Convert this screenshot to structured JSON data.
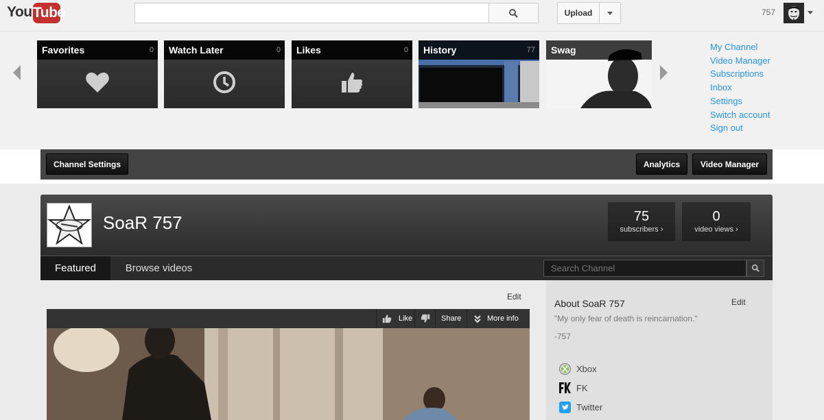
{
  "header": {
    "logo_you": "You",
    "logo_tube": "Tube",
    "search_placeholder": "",
    "upload_label": "Upload",
    "username": "757"
  },
  "guide": {
    "tiles": [
      {
        "title": "Favorites",
        "count": "0",
        "icon": "heart-icon"
      },
      {
        "title": "Watch Later",
        "count": "0",
        "icon": "clock-icon"
      },
      {
        "title": "Likes",
        "count": "0",
        "icon": "thumbs-up-icon"
      },
      {
        "title": "History",
        "count": "77",
        "icon": "history-thumbnail"
      },
      {
        "title": "Swag",
        "count": "",
        "icon": "swag-thumbnail"
      }
    ],
    "links": [
      "My Channel",
      "Video Manager",
      "Subscriptions",
      "Inbox",
      "Settings",
      "Switch account",
      "Sign out"
    ]
  },
  "owner_bar": {
    "channel_settings": "Channel Settings",
    "analytics": "Analytics",
    "video_manager": "Video Manager"
  },
  "channel": {
    "name": "SoaR 757",
    "subscribers": {
      "value": "75",
      "label": "subscribers ›"
    },
    "video_views": {
      "value": "0",
      "label": "video views ›"
    },
    "tabs": [
      "Featured",
      "Browse videos"
    ],
    "active_tab": "Featured",
    "search_placeholder": "Search Channel"
  },
  "featured": {
    "edit_label": "Edit",
    "actions": {
      "like": "Like",
      "share": "Share",
      "more": "More info"
    }
  },
  "about": {
    "title": "About SoaR 757",
    "edit_label": "Edit",
    "quote": "\"My only fear of death is reincarnation.\"",
    "signature": "-757",
    "links": [
      {
        "label": "Xbox",
        "icon": "xbox-icon"
      },
      {
        "label": "FK",
        "icon": "fk-icon"
      },
      {
        "label": "Twitter",
        "icon": "twitter-icon"
      }
    ]
  },
  "colors": {
    "brand_red": "#c4302b",
    "link_blue": "#2793e6",
    "dark_bar": "#444444"
  }
}
